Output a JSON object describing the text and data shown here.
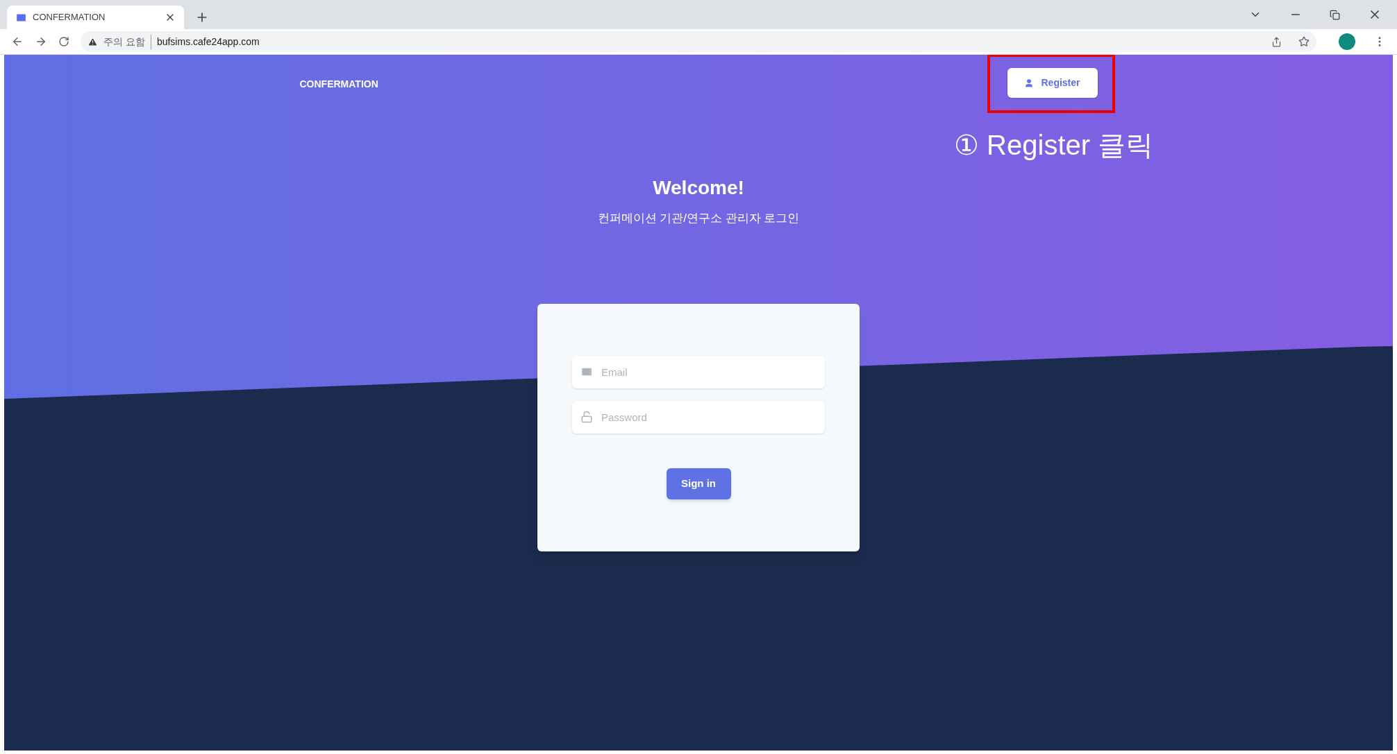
{
  "browser": {
    "tab": {
      "title": "CONFERMATION"
    },
    "address": {
      "security_label": "주의 요함",
      "url": "bufsims.cafe24app.com"
    }
  },
  "nav": {
    "brand": "CONFERMATION",
    "register_button": "Register"
  },
  "annotation": {
    "text": "① Register 클릭"
  },
  "hero": {
    "title": "Welcome!",
    "subtitle": "컨퍼메이션 기관/연구소 관리자 로그인"
  },
  "login": {
    "fields": [
      {
        "kind": "email",
        "placeholder": "Email"
      },
      {
        "kind": "password",
        "placeholder": "Password"
      }
    ],
    "submit": "Sign in"
  }
}
